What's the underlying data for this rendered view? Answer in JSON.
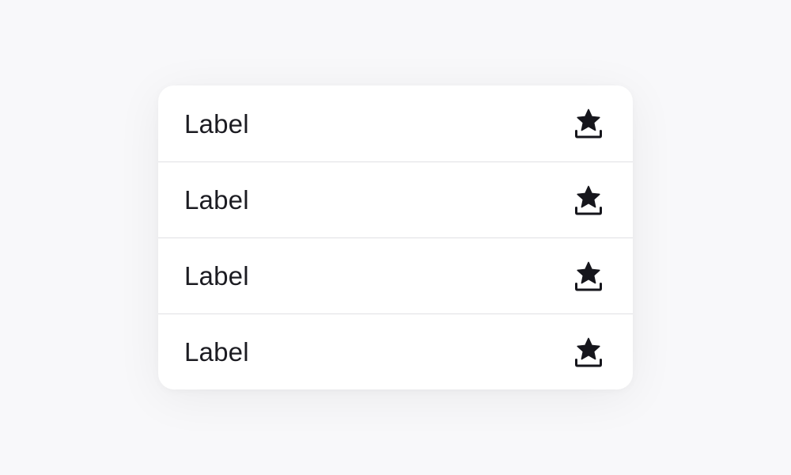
{
  "menu": {
    "items": [
      {
        "label": "Label",
        "icon": "star-tray-icon"
      },
      {
        "label": "Label",
        "icon": "star-tray-icon"
      },
      {
        "label": "Label",
        "icon": "star-tray-icon"
      },
      {
        "label": "Label",
        "icon": "star-tray-icon"
      }
    ]
  },
  "colors": {
    "background": "#f8f8fa",
    "card": "#ffffff",
    "text": "#1c1c22",
    "divider": "#e0e0e4",
    "icon": "#16161c"
  }
}
